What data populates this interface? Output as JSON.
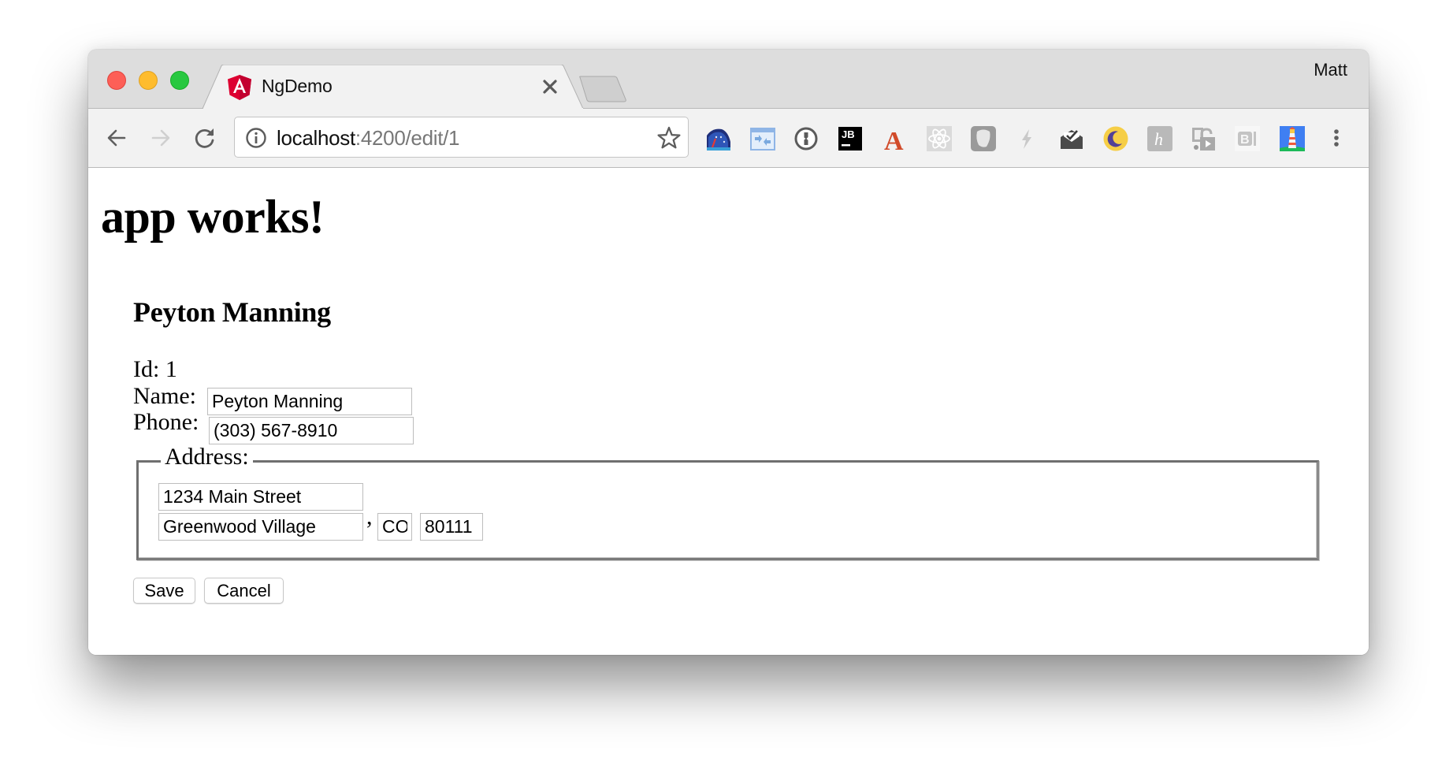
{
  "window": {
    "profile_name": "Matt"
  },
  "tabs": [
    {
      "title": "NgDemo",
      "favicon": "angular-icon",
      "active": true
    }
  ],
  "toolbar": {
    "back": "arrow-left-icon",
    "forward": "arrow-right-icon",
    "reload": "reload-icon",
    "omnibox": {
      "security_icon": "info-icon",
      "host": "localhost",
      "path": ":4200/edit/1",
      "bookmark_icon": "star-icon"
    },
    "extensions": [
      "speedometer-extension-icon",
      "window-arrows-extension-icon",
      "1password-extension-icon",
      "jetbrains-extension-icon",
      "letter-a-extension-icon",
      "react-devtools-extension-icon",
      "ghostery-extension-icon",
      "lightning-bolt-extension-icon",
      "mail-check-extension-icon",
      "moon-extension-icon",
      "h-extension-icon",
      "film-unlock-extension-icon",
      "b-extension-icon",
      "lighthouse-extension-icon"
    ],
    "menu": "more-vertical-icon"
  },
  "page": {
    "heading": "app works!",
    "subheading": "Peyton Manning",
    "id_label": "Id:",
    "id_value": "1",
    "name_label": "Name:",
    "name_value": "Peyton Manning",
    "phone_label": "Phone:",
    "phone_value": "(303) 567-8910",
    "address": {
      "legend": "Address:",
      "street": "1234 Main Street",
      "city": "Greenwood Village",
      "separator": ",",
      "state": "CO",
      "zip": "80111"
    },
    "buttons": {
      "save": "Save",
      "cancel": "Cancel"
    }
  }
}
